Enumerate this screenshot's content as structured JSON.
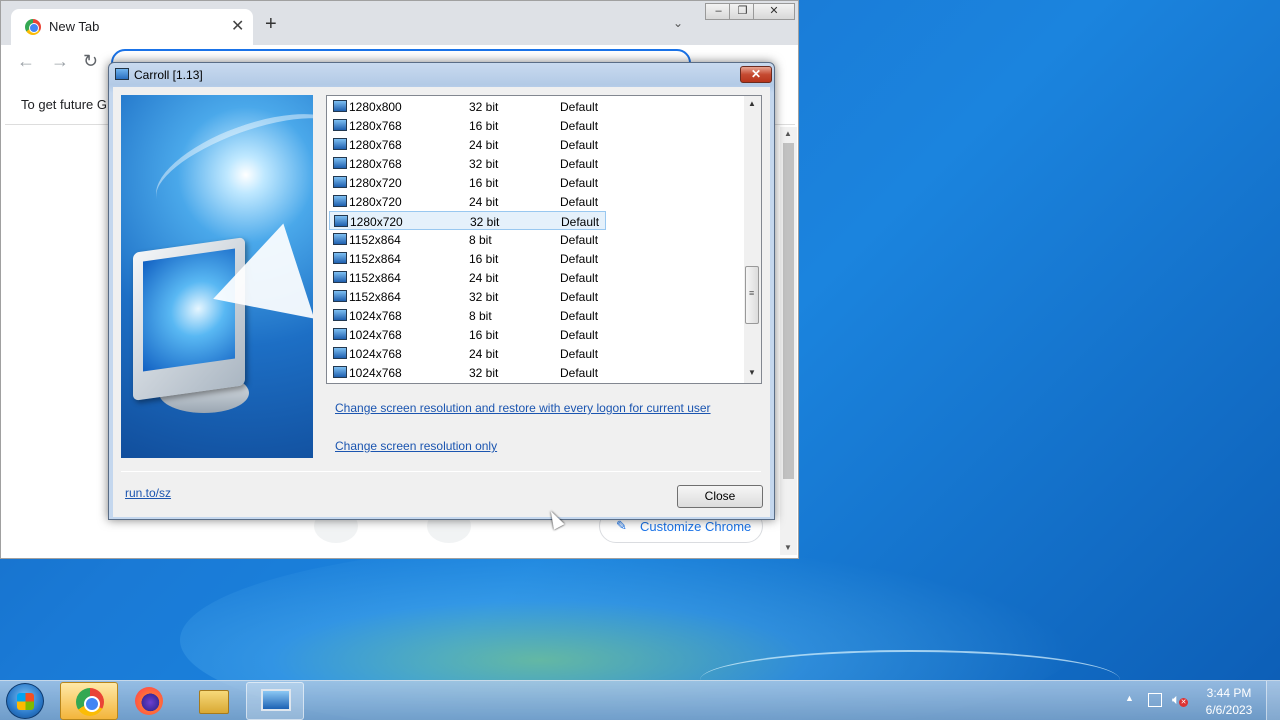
{
  "chrome": {
    "tab_title": "New Tab",
    "tab_close": "✕",
    "new_tab": "+",
    "dropdown": "⌄",
    "back": "←",
    "forward": "→",
    "reload": "↻",
    "info_text": "To get future G",
    "customize_label": "Customize Chrome",
    "window_minimize": "–",
    "window_restore": "❐",
    "window_close": "✕"
  },
  "dialog": {
    "title": "Carroll [1.13]",
    "close_glyph": "✕",
    "resolutions": [
      {
        "name": "1280x800",
        "depth": "32 bit",
        "freq": "Default",
        "selected": false
      },
      {
        "name": "1280x768",
        "depth": "16 bit",
        "freq": "Default",
        "selected": false
      },
      {
        "name": "1280x768",
        "depth": "24 bit",
        "freq": "Default",
        "selected": false
      },
      {
        "name": "1280x768",
        "depth": "32 bit",
        "freq": "Default",
        "selected": false
      },
      {
        "name": "1280x720",
        "depth": "16 bit",
        "freq": "Default",
        "selected": false
      },
      {
        "name": "1280x720",
        "depth": "24 bit",
        "freq": "Default",
        "selected": false
      },
      {
        "name": "1280x720",
        "depth": "32 bit",
        "freq": "Default",
        "selected": true
      },
      {
        "name": "1152x864",
        "depth": "8 bit",
        "freq": "Default",
        "selected": false
      },
      {
        "name": "1152x864",
        "depth": "16 bit",
        "freq": "Default",
        "selected": false
      },
      {
        "name": "1152x864",
        "depth": "24 bit",
        "freq": "Default",
        "selected": false
      },
      {
        "name": "1152x864",
        "depth": "32 bit",
        "freq": "Default",
        "selected": false
      },
      {
        "name": "1024x768",
        "depth": "8 bit",
        "freq": "Default",
        "selected": false
      },
      {
        "name": "1024x768",
        "depth": "16 bit",
        "freq": "Default",
        "selected": false
      },
      {
        "name": "1024x768",
        "depth": "24 bit",
        "freq": "Default",
        "selected": false
      },
      {
        "name": "1024x768",
        "depth": "32 bit",
        "freq": "Default",
        "selected": false
      }
    ],
    "link_persist": "Change screen resolution and restore with every logon for current user",
    "link_only": "Change screen resolution only",
    "footer_link": "run.to/sz",
    "close_button": "Close"
  },
  "taskbar": {
    "items": [
      {
        "name": "chrome",
        "state": "active"
      },
      {
        "name": "firefox",
        "state": "idle"
      },
      {
        "name": "file-explorer",
        "state": "idle"
      },
      {
        "name": "carroll",
        "state": "open"
      }
    ],
    "clock_time": "3:44 PM",
    "clock_date": "6/6/2023"
  },
  "colors": {
    "desktop": "#1a7ad6",
    "link": "#1b55b0",
    "selection": "#e5f1fb",
    "chrome_accent": "#1a73e8"
  }
}
